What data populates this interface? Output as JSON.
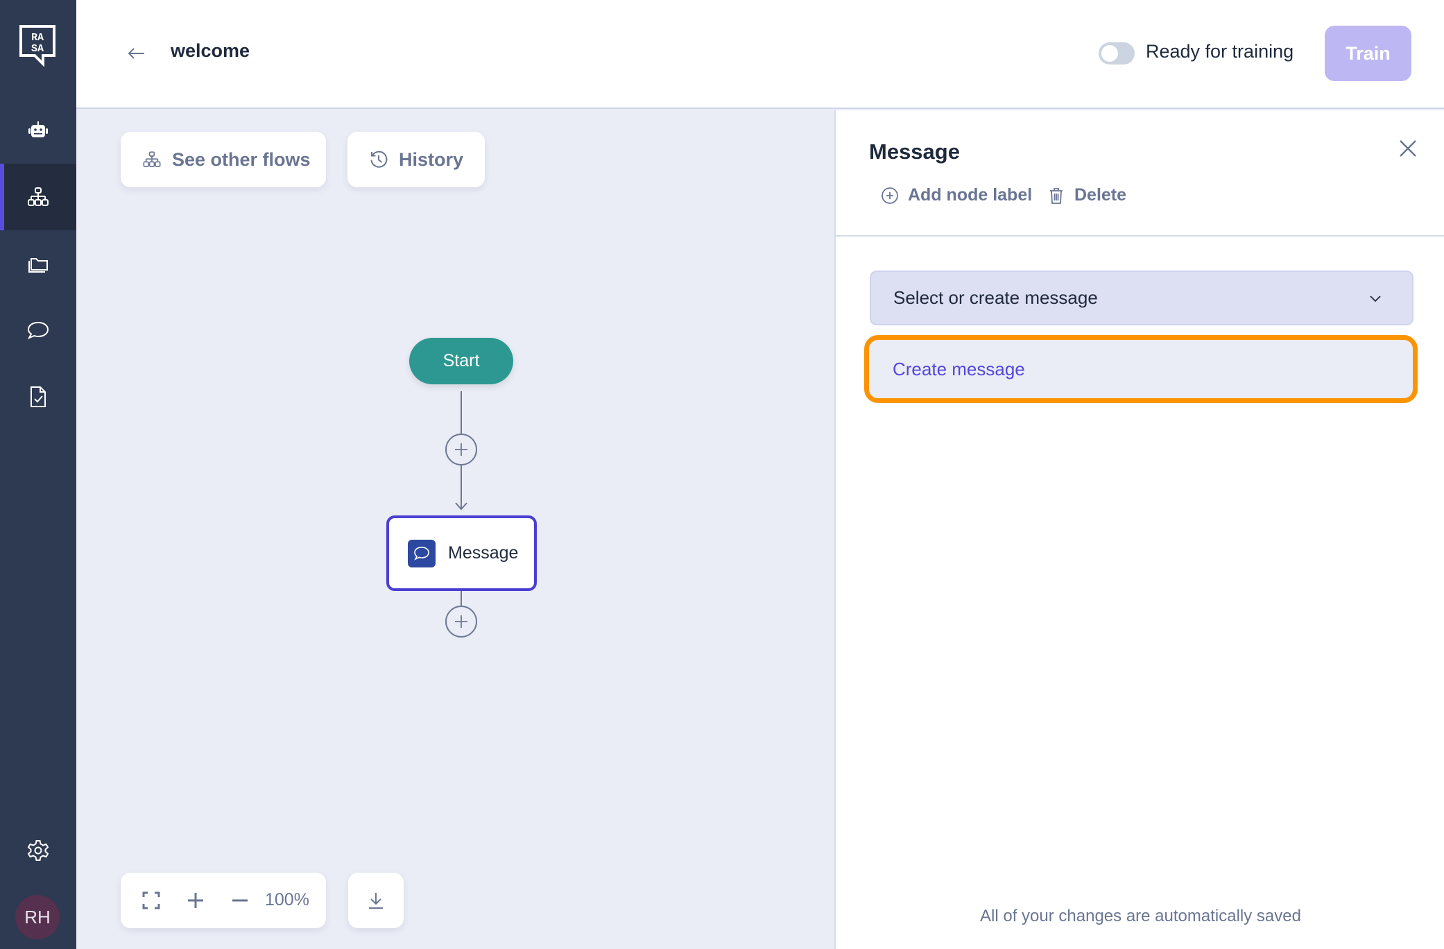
{
  "app": {
    "logo_text": "RASA"
  },
  "sidebar": {
    "items": [
      {
        "name": "assistant",
        "icon": "robot-icon",
        "active": false
      },
      {
        "name": "flows",
        "icon": "flows-icon",
        "active": true
      },
      {
        "name": "content",
        "icon": "folder-icon",
        "active": false
      },
      {
        "name": "conversations",
        "icon": "chat-icon",
        "active": false
      },
      {
        "name": "testing",
        "icon": "file-check-icon",
        "active": false
      }
    ],
    "settings_icon": "gear-icon",
    "avatar_initials": "RH",
    "accent_color": "#5b4ce0"
  },
  "header": {
    "back_icon": "arrow-left-icon",
    "title": "welcome",
    "toggle_label": "Ready for training",
    "toggle_on": false,
    "train_label": "Train"
  },
  "canvas": {
    "see_other_flows_label": "See other flows",
    "history_label": "History",
    "nodes": {
      "start_label": "Start",
      "message_label": "Message"
    },
    "zoom_level": "100%"
  },
  "panel": {
    "title": "Message",
    "add_node_label": "Add node label",
    "delete_label": "Delete",
    "select_placeholder": "Select or create message",
    "create_option_label": "Create message",
    "autosave_text": "All of your changes are automatically saved",
    "highlight_color": "#fb9403"
  }
}
